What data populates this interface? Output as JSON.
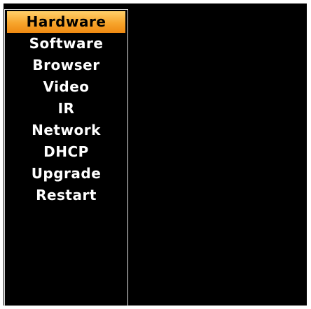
{
  "menu": {
    "selected_index": 0,
    "selected_color": "#f5a030",
    "items": [
      {
        "label": "Hardware"
      },
      {
        "label": "Software"
      },
      {
        "label": "Browser"
      },
      {
        "label": "Video"
      },
      {
        "label": "IR"
      },
      {
        "label": "Network"
      },
      {
        "label": "DHCP"
      },
      {
        "label": "Upgrade"
      },
      {
        "label": "Restart"
      }
    ]
  }
}
